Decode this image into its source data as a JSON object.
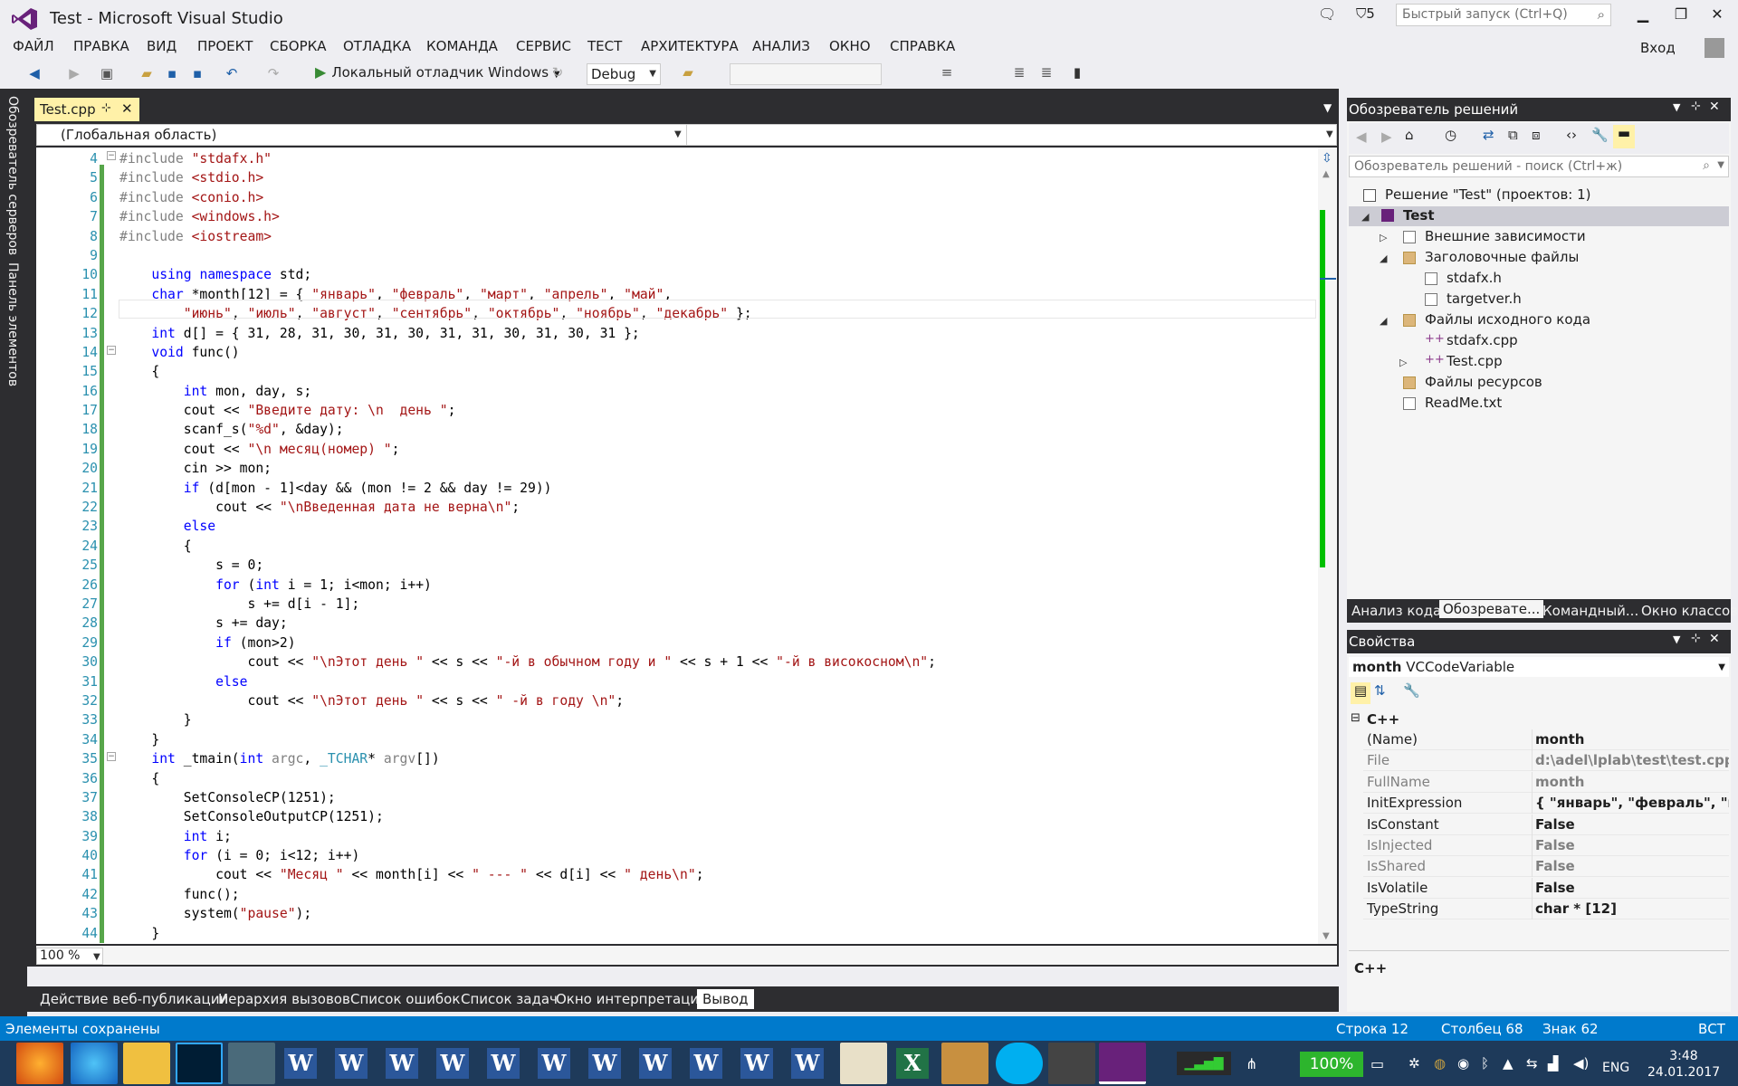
{
  "window": {
    "title": "Test - Microsoft Visual Studio",
    "notifications_count": "5",
    "quick_launch_placeholder": "Быстрый запуск (Ctrl+Q)",
    "login": "Вход"
  },
  "menu": [
    "ФАЙЛ",
    "ПРАВКА",
    "ВИД",
    "ПРОЕКТ",
    "СБОРКА",
    "ОТЛАДКА",
    "КОМАНДА",
    "СЕРВИС",
    "ТЕСТ",
    "АРХИТЕКТУРА",
    "АНАЛИЗ",
    "ОКНО",
    "СПРАВКА"
  ],
  "toolbar": {
    "run_label": "Локальный отладчик Windows",
    "configuration": "Debug"
  },
  "left_rail": [
    "Обозреватель серверов",
    "Панель элементов"
  ],
  "editor": {
    "tab_label": "Test.cpp",
    "scope": "(Глобальная область)",
    "zoom": "100 %"
  },
  "code_lines": [
    {
      "n": "4",
      "html": "<span class=\"pp\">#include</span> <span class=\"str\">\"stdafx.h\"</span>"
    },
    {
      "n": "5",
      "html": "<span class=\"pp\">#include</span> <span class=\"str\">&lt;stdio.h&gt;</span>"
    },
    {
      "n": "6",
      "html": "<span class=\"pp\">#include</span> <span class=\"str\">&lt;conio.h&gt;</span>"
    },
    {
      "n": "7",
      "html": "<span class=\"pp\">#include</span> <span class=\"str\">&lt;windows.h&gt;</span>"
    },
    {
      "n": "8",
      "html": "<span class=\"pp\">#include</span> <span class=\"str\">&lt;iostream&gt;</span>"
    },
    {
      "n": "9",
      "html": ""
    },
    {
      "n": "10",
      "html": "    <span class=\"kw\">using</span> <span class=\"kw\">namespace</span> std;"
    },
    {
      "n": "11",
      "html": "    <span class=\"kw\">char</span> *month[12] = { <span class=\"str\">\"январь\"</span>, <span class=\"str\">\"февраль\"</span>, <span class=\"str\">\"март\"</span>, <span class=\"str\">\"апрель\"</span>, <span class=\"str\">\"май\"</span>,"
    },
    {
      "n": "12",
      "html": "        <span class=\"str\">\"июнь\"</span>, <span class=\"str\">\"июль\"</span>, <span class=\"str\">\"август\"</span>, <span class=\"str\">\"сентябрь\"</span>, <span class=\"str\">\"октябрь\"</span>, <span class=\"str\">\"ноябрь\"</span>, <span class=\"str\">\"декабрь\"</span> };"
    },
    {
      "n": "13",
      "html": "    <span class=\"kw\">int</span> d[] = { 31, 28, 31, 30, 31, 30, 31, 31, 30, 31, 30, 31 };"
    },
    {
      "n": "14",
      "html": "    <span class=\"kw\">void</span> func()"
    },
    {
      "n": "15",
      "html": "    {"
    },
    {
      "n": "16",
      "html": "        <span class=\"kw\">int</span> mon, day, s;"
    },
    {
      "n": "17",
      "html": "        cout &lt;&lt; <span class=\"str\">\"Введите дату: \\n  день \"</span>;"
    },
    {
      "n": "18",
      "html": "        scanf_s(<span class=\"str\">\"%d\"</span>, &amp;day);"
    },
    {
      "n": "19",
      "html": "        cout &lt;&lt; <span class=\"str\">\"\\n месяц(номер) \"</span>;"
    },
    {
      "n": "20",
      "html": "        cin &gt;&gt; mon;"
    },
    {
      "n": "21",
      "html": "        <span class=\"kw\">if</span> (d[mon - 1]&lt;day &amp;&amp; (mon != 2 &amp;&amp; day != 29))"
    },
    {
      "n": "22",
      "html": "            cout &lt;&lt; <span class=\"str\">\"\\nВведенная дата не верна\\n\"</span>;"
    },
    {
      "n": "23",
      "html": "        <span class=\"kw\">else</span>"
    },
    {
      "n": "24",
      "html": "        {"
    },
    {
      "n": "25",
      "html": "            s = 0;"
    },
    {
      "n": "26",
      "html": "            <span class=\"kw\">for</span> (<span class=\"kw\">int</span> i = 1; i&lt;mon; i++)"
    },
    {
      "n": "27",
      "html": "                s += d[i - 1];"
    },
    {
      "n": "28",
      "html": "            s += day;"
    },
    {
      "n": "29",
      "html": "            <span class=\"kw\">if</span> (mon&gt;2)"
    },
    {
      "n": "30",
      "html": "                cout &lt;&lt; <span class=\"str\">\"\\nЭтот день \"</span> &lt;&lt; s &lt;&lt; <span class=\"str\">\"-й в обычном году и \"</span> &lt;&lt; s + 1 &lt;&lt; <span class=\"str\">\"-й в високосном\\n\"</span>;"
    },
    {
      "n": "31",
      "html": "            <span class=\"kw\">else</span>"
    },
    {
      "n": "32",
      "html": "                cout &lt;&lt; <span class=\"str\">\"\\nЭтот день \"</span> &lt;&lt; s &lt;&lt; <span class=\"str\">\" -й в году \\n\"</span>;"
    },
    {
      "n": "33",
      "html": "        }"
    },
    {
      "n": "34",
      "html": "    }"
    },
    {
      "n": "35",
      "html": "    <span class=\"kw\">int</span> _tmain(<span class=\"kw\">int</span> <span class=\"gr\">argc</span>, <span class=\"ty\">_TCHAR</span>* <span class=\"gr\">argv</span>[])"
    },
    {
      "n": "36",
      "html": "    {"
    },
    {
      "n": "37",
      "html": "        SetConsoleCP(1251);"
    },
    {
      "n": "38",
      "html": "        SetConsoleOutputCP(1251);"
    },
    {
      "n": "39",
      "html": "        <span class=\"kw\">int</span> i;"
    },
    {
      "n": "40",
      "html": "        <span class=\"kw\">for</span> (i = 0; i&lt;12; i++)"
    },
    {
      "n": "41",
      "html": "            cout &lt;&lt; <span class=\"str\">\"Месяц \"</span> &lt;&lt; month[i] &lt;&lt; <span class=\"str\">\" --- \"</span> &lt;&lt; d[i] &lt;&lt; <span class=\"str\">\" день\\n\"</span>;"
    },
    {
      "n": "42",
      "html": "        func();"
    },
    {
      "n": "43",
      "html": "        system(<span class=\"str\">\"pause\"</span>);"
    },
    {
      "n": "44",
      "html": "    }"
    },
    {
      "n": "45",
      "html": ""
    }
  ],
  "bottom_tabs": [
    "Действие веб-публикации",
    "Иерархия вызовов",
    "Список ошибок",
    "Список задач",
    "Окно интерпретации",
    "Вывод"
  ],
  "solution_explorer": {
    "title": "Обозреватель решений",
    "search_placeholder": "Обозреватель решений - поиск (Ctrl+ж)",
    "tree": [
      {
        "label": "Решение \"Test\"  (проектов: 1)"
      },
      {
        "label": "Test"
      },
      {
        "label": "Внешние зависимости"
      },
      {
        "label": "Заголовочные файлы"
      },
      {
        "label": "stdafx.h"
      },
      {
        "label": "targetver.h"
      },
      {
        "label": "Файлы исходного кода"
      },
      {
        "label": "stdafx.cpp"
      },
      {
        "label": "Test.cpp"
      },
      {
        "label": "Файлы ресурсов"
      },
      {
        "label": "ReadMe.txt"
      }
    ],
    "tabs": [
      "Анализ кода",
      "Обозревате...",
      "Командный...",
      "Окно классов"
    ]
  },
  "properties": {
    "title": "Свойства",
    "object_name": "month",
    "object_type": "VCCodeVariable",
    "category": "C++",
    "rows": [
      {
        "name": "(Name)",
        "value": "month"
      },
      {
        "name": "File",
        "value": "d:\\adel\\lplab\\test\\test.cpp"
      },
      {
        "name": "FullName",
        "value": "month"
      },
      {
        "name": "InitExpression",
        "value": "{ \"январь\", \"февраль\", \"март\""
      },
      {
        "name": "IsConstant",
        "value": "False"
      },
      {
        "name": "IsInjected",
        "value": "False"
      },
      {
        "name": "IsShared",
        "value": "False"
      },
      {
        "name": "IsVolatile",
        "value": "False"
      },
      {
        "name": "TypeString",
        "value": "char * [12]"
      }
    ],
    "description": "C++"
  },
  "status": {
    "message": "Элементы сохранены",
    "line": "Строка 12",
    "column": "Столбец 68",
    "char": "Знак 62",
    "mode": "ВСТ"
  },
  "taskbar": {
    "battery": "100%",
    "lang": "ENG",
    "time": "3:48",
    "date": "24.01.2017"
  }
}
